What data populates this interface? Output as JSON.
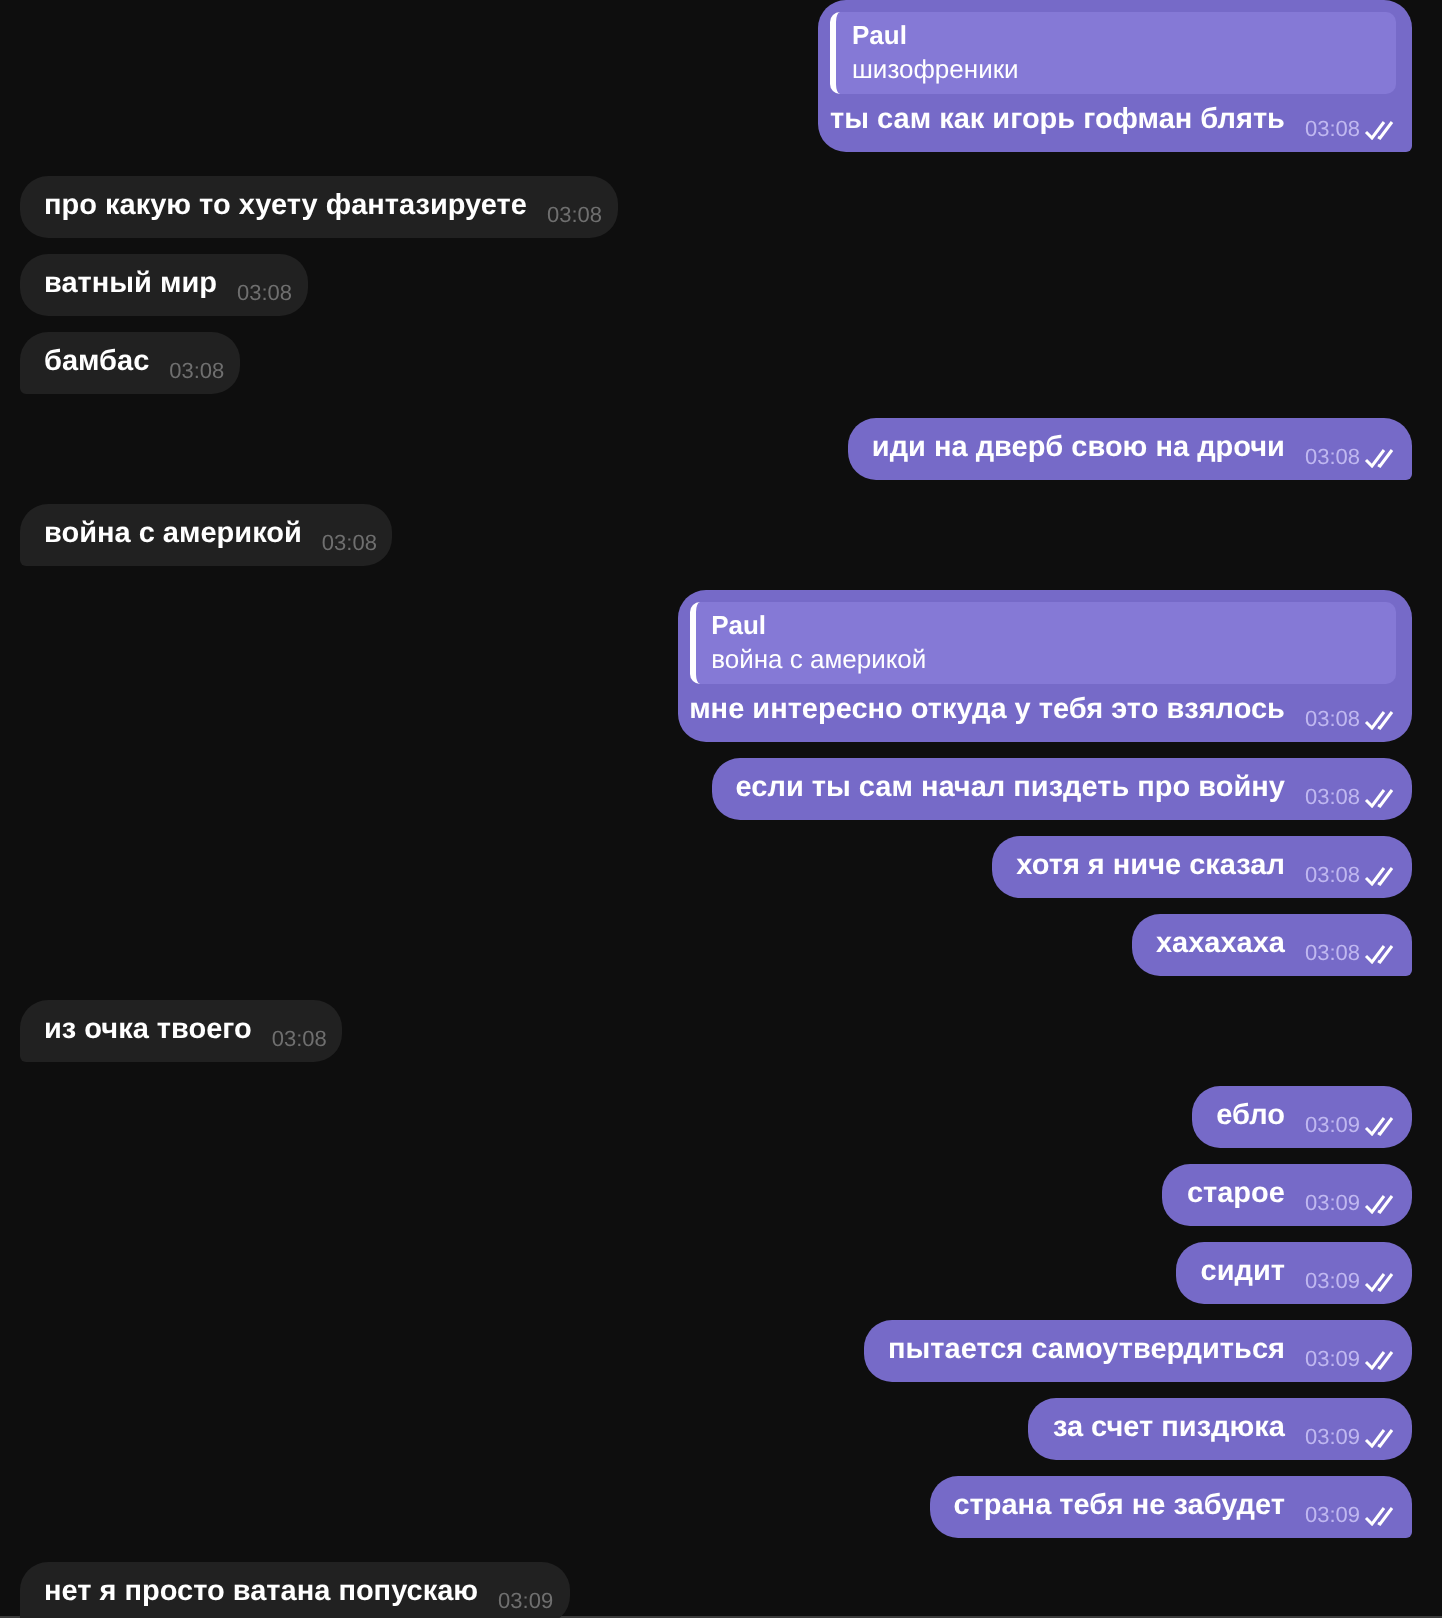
{
  "messages": [
    {
      "kind": "outgoing",
      "reply": {
        "author": "Paul",
        "text": "шизофреники"
      },
      "text": "ты сам как игорь гофман блять",
      "time": "03:08",
      "read": true
    },
    {
      "kind": "incoming",
      "text": "про какую то хуету фантазируете",
      "time": "03:08"
    },
    {
      "kind": "incoming",
      "text": "ватный мир",
      "time": "03:08"
    },
    {
      "kind": "incoming",
      "text": "бамбас",
      "time": "03:08"
    },
    {
      "kind": "outgoing",
      "text": "иди на дверб свою на дрочи",
      "time": "03:08",
      "read": true
    },
    {
      "kind": "incoming",
      "text": "война с америкой",
      "time": "03:08"
    },
    {
      "kind": "outgoing",
      "reply": {
        "author": "Paul",
        "text": "война с америкой"
      },
      "text": "мне интересно откуда у тебя это взялось",
      "time": "03:08",
      "read": true
    },
    {
      "kind": "outgoing",
      "text": "если ты сам начал пиздеть про войну",
      "time": "03:08",
      "read": true
    },
    {
      "kind": "outgoing",
      "text": "хотя я ниче сказал",
      "time": "03:08",
      "read": true
    },
    {
      "kind": "outgoing",
      "text": "хахахаха",
      "time": "03:08",
      "read": true
    },
    {
      "kind": "incoming",
      "text": "из очка твоего",
      "time": "03:08"
    },
    {
      "kind": "outgoing",
      "text": "ебло",
      "time": "03:09",
      "read": true
    },
    {
      "kind": "outgoing",
      "text": "старое",
      "time": "03:09",
      "read": true
    },
    {
      "kind": "outgoing",
      "text": "сидит",
      "time": "03:09",
      "read": true
    },
    {
      "kind": "outgoing",
      "text": "пытается самоутвердиться",
      "time": "03:09",
      "read": true
    },
    {
      "kind": "outgoing",
      "text": "за счет пиздюка",
      "time": "03:09",
      "read": true
    },
    {
      "kind": "outgoing",
      "text": "страна тебя не забудет",
      "time": "03:09",
      "read": true
    },
    {
      "kind": "incoming",
      "text": "нет я просто ватана попускаю",
      "time": "03:09"
    }
  ]
}
